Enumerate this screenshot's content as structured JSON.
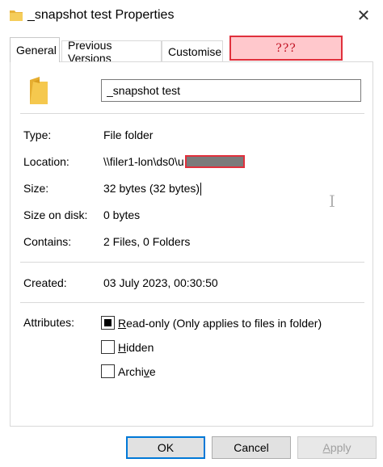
{
  "window": {
    "title": "_snapshot test Properties",
    "close_glyph": "✕"
  },
  "tabs": [
    {
      "label": "General",
      "active": true
    },
    {
      "label": "Previous Versions",
      "active": false
    },
    {
      "label": "Customise",
      "active": false
    }
  ],
  "redacted_tab_text": "???",
  "general": {
    "folder_name": "_snapshot test",
    "rows": {
      "type": {
        "label": "Type:",
        "value": "File folder"
      },
      "location": {
        "label": "Location:",
        "value": "\\\\filer1-lon\\ds0\\u"
      },
      "size": {
        "label": "Size:",
        "value": "32 bytes (32 bytes)"
      },
      "size_on_disk": {
        "label": "Size on disk:",
        "value": "0 bytes"
      },
      "contains": {
        "label": "Contains:",
        "value": "2 Files, 0 Folders"
      },
      "created": {
        "label": "Created:",
        "value": "03 July 2023, 00:30:50"
      }
    },
    "attributes": {
      "label": "Attributes:",
      "readonly": {
        "first_letter": "R",
        "rest": "ead-only (Only applies to files in folder)",
        "state": "indeterminate"
      },
      "hidden": {
        "first_letter": "H",
        "rest": "idden",
        "state": "unchecked"
      },
      "archive": {
        "lead": "Archi",
        "underlined": "v",
        "rest": "e",
        "state": "unchecked"
      }
    }
  },
  "buttons": {
    "ok": "OK",
    "cancel": "Cancel",
    "apply_first": "A",
    "apply_rest": "pply"
  },
  "colors": {
    "folder": "#f0c24a",
    "redaction_border": "#e0303c",
    "redaction_fill": "#ffc8cc",
    "focus_blue": "#0078d7"
  },
  "icons": {
    "title": "folder-icon",
    "big": "folder-icon",
    "close": "close-icon",
    "cursor": "text-cursor-icon"
  }
}
